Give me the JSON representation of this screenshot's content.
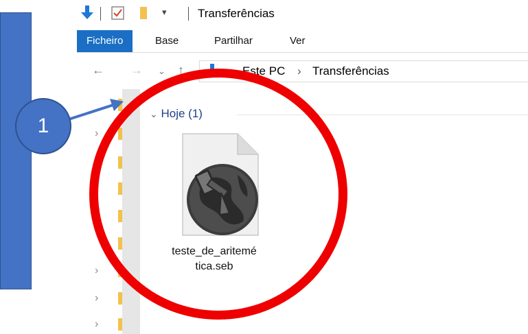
{
  "window": {
    "title": "Transferências"
  },
  "ribbon": {
    "tabs": [
      "Ficheiro",
      "Base",
      "Partilhar",
      "Ver"
    ]
  },
  "address": {
    "crumbs": [
      "Este PC",
      "Transferências"
    ]
  },
  "content": {
    "group_header": "Hoje (1)",
    "file": {
      "name_line1": "teste_de_aritemé",
      "name_line2": "tica.seb"
    }
  },
  "annotation": {
    "callout_number": "1"
  },
  "colors": {
    "callout_blue": "#4472C4",
    "circle_red": "#EE0000",
    "tab_active": "#1A6FC4",
    "folder_yellow": "#F2C14E"
  },
  "icons": [
    "down-arrow-icon",
    "checkbox-icon",
    "folder-icon",
    "dropdown-arrow-icon",
    "back-arrow-icon",
    "forward-arrow-icon",
    "recent-dropdown-icon",
    "up-arrow-icon",
    "seb-file-icon",
    "chevron-right-icon"
  ]
}
